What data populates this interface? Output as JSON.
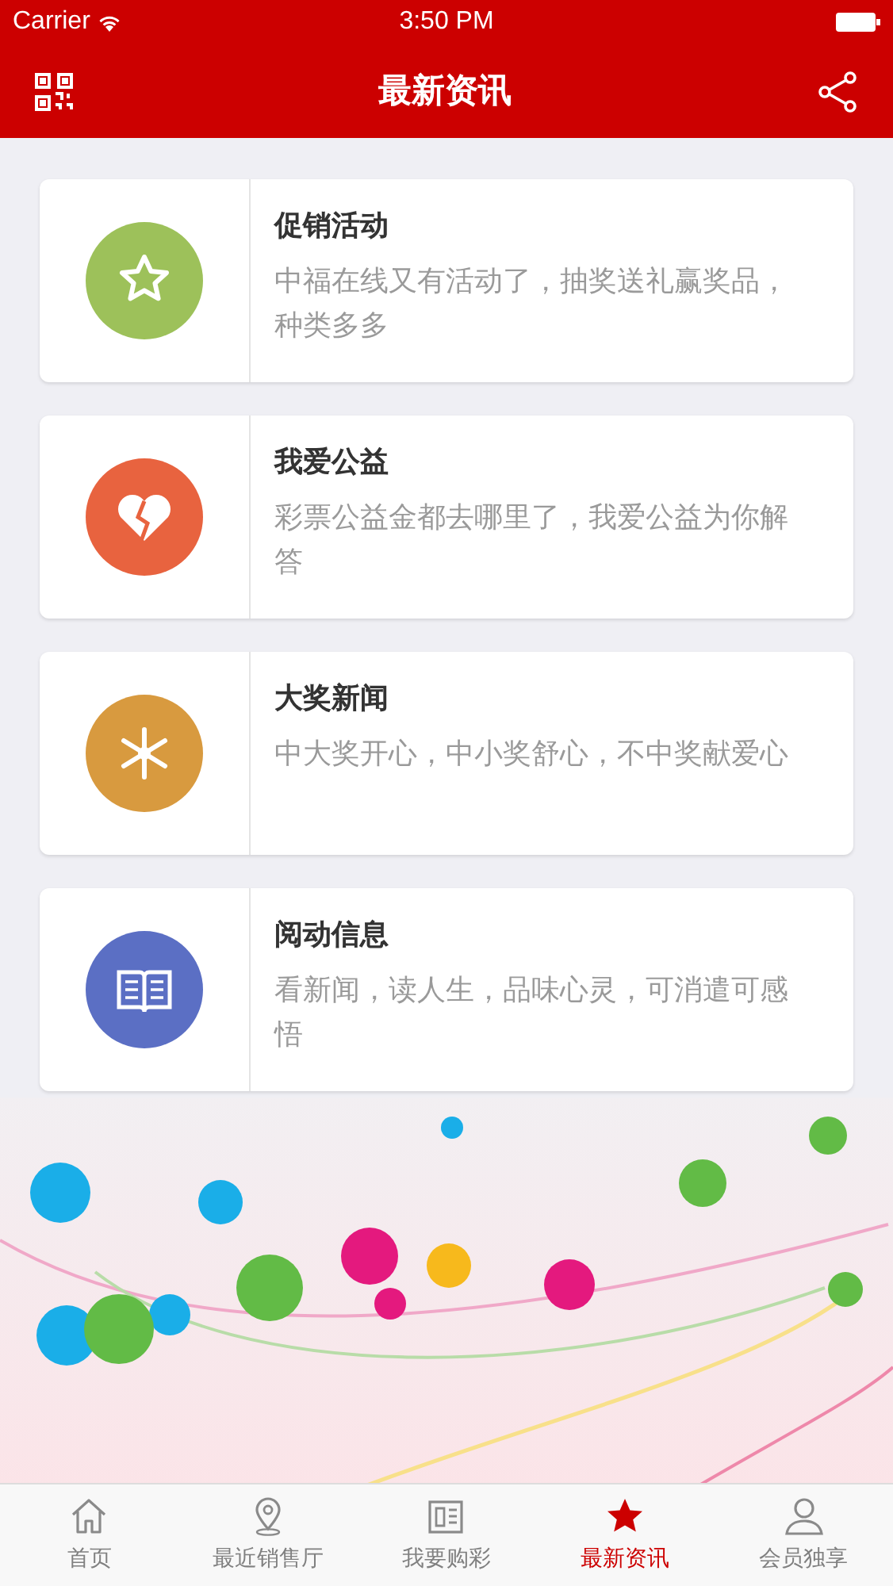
{
  "status_bar": {
    "carrier": "Carrier",
    "time": "3:50 PM"
  },
  "header": {
    "title": "最新资讯"
  },
  "cards": [
    {
      "title": "促销活动",
      "description": "中福在线又有活动了，抽奖送礼赢奖品，种类多多",
      "color": "#9dc15a"
    },
    {
      "title": "我爱公益",
      "description": "彩票公益金都去哪里了，我爱公益为你解答",
      "color": "#e8633f"
    },
    {
      "title": "大奖新闻",
      "description": "中大奖开心，中小奖舒心，不中奖献爱心",
      "color": "#d89a3f"
    },
    {
      "title": "阅动信息",
      "description": "看新闻，读人生，品味心灵，可消遣可感悟",
      "color": "#5b6fc4"
    }
  ],
  "tab_bar": [
    {
      "label": "首页",
      "selected": false
    },
    {
      "label": "最近销售厅",
      "selected": false
    },
    {
      "label": "我要购彩",
      "selected": false
    },
    {
      "label": "最新资讯",
      "selected": true
    },
    {
      "label": "会员独享",
      "selected": false
    }
  ]
}
